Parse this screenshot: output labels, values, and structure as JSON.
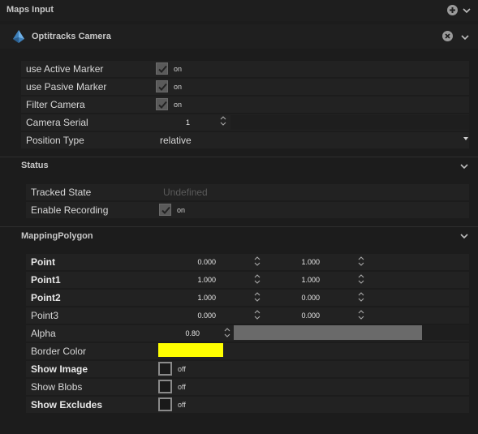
{
  "panel": {
    "title": "Maps Input"
  },
  "camera": {
    "title": "Optitracks Camera",
    "use_active_marker": {
      "label": "use Active Marker",
      "checked": true,
      "state": "on"
    },
    "use_pasive_marker": {
      "label": "use Pasive Marker",
      "checked": true,
      "state": "on"
    },
    "filter_camera": {
      "label": "Filter Camera",
      "checked": true,
      "state": "on"
    },
    "camera_serial": {
      "label": "Camera Serial",
      "value": "1"
    },
    "position_type": {
      "label": "Position Type",
      "value": "relative"
    }
  },
  "status": {
    "title": "Status",
    "tracked_state": {
      "label": "Tracked State",
      "value": "Undefined"
    },
    "enable_recording": {
      "label": "Enable Recording",
      "checked": true,
      "state": "on"
    }
  },
  "mapping": {
    "title": "MappingPolygon",
    "points": [
      {
        "label": "Point",
        "x": "0.000",
        "y": "1.000"
      },
      {
        "label": "Point1",
        "x": "1.000",
        "y": "1.000"
      },
      {
        "label": "Point2",
        "x": "1.000",
        "y": "0.000"
      },
      {
        "label": "Point3",
        "x": "0.000",
        "y": "0.000"
      }
    ],
    "alpha": {
      "label": "Alpha",
      "value": "0.80",
      "level": 0.8
    },
    "border_color": {
      "label": "Border Color",
      "color": "#ffff00"
    },
    "show_image": {
      "label": "Show Image",
      "checked": false,
      "state": "off"
    },
    "show_blobs": {
      "label": "Show Blobs",
      "checked": false,
      "state": "off"
    },
    "show_excludes": {
      "label": "Show Excludes",
      "checked": false,
      "state": "off"
    }
  },
  "colors": {
    "background": "#1c1c1c",
    "row": "#222222",
    "accent_yellow": "#ffff00",
    "slider_fill": "#6a6a6a"
  }
}
